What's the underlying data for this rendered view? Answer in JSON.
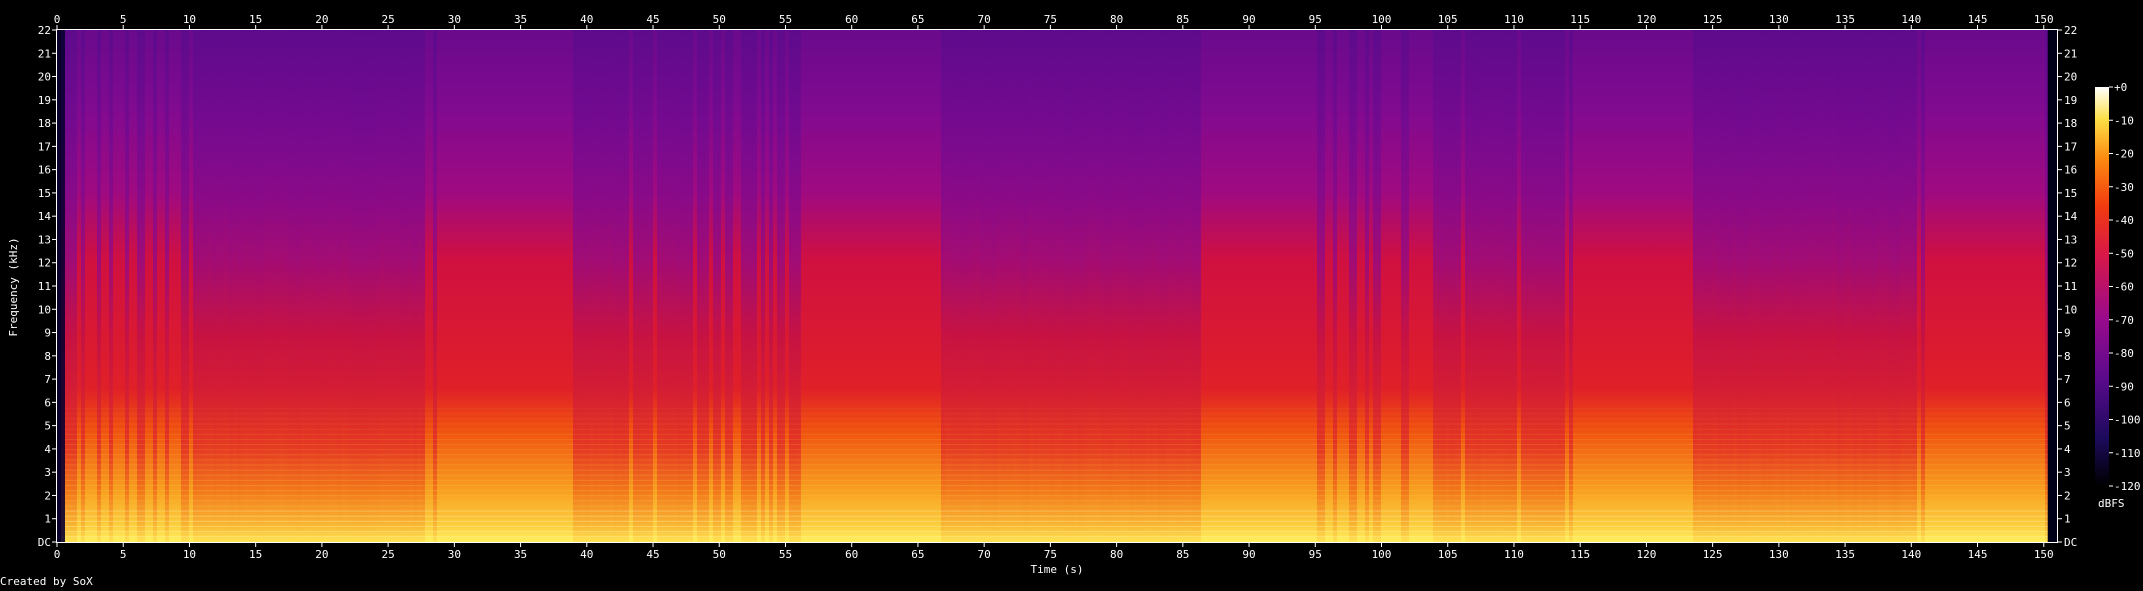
{
  "chart_data": {
    "type": "heatmap",
    "title": "",
    "xlabel": "Time (s)",
    "ylabel": "Frequency (kHz)",
    "xlim": [
      0,
      151
    ],
    "ylim": [
      0,
      22
    ],
    "x_ticks": [
      "0",
      "5",
      "10",
      "15",
      "20",
      "25",
      "30",
      "35",
      "40",
      "45",
      "50",
      "55",
      "60",
      "65",
      "70",
      "75",
      "80",
      "85",
      "90",
      "95",
      "100",
      "105",
      "110",
      "115",
      "120",
      "125",
      "130",
      "135",
      "140",
      "145",
      "150"
    ],
    "y_ticks": [
      "DC",
      "1",
      "2",
      "3",
      "4",
      "5",
      "6",
      "7",
      "8",
      "9",
      "10",
      "11",
      "12",
      "13",
      "14",
      "15",
      "16",
      "17",
      "18",
      "19",
      "20",
      "21",
      "22"
    ],
    "colorbar": {
      "label": "dBFS",
      "ticks": [
        "+0",
        "-10",
        "-20",
        "-30",
        "-40",
        "-50",
        "-60",
        "-70",
        "-80",
        "-90",
        "-100",
        "-110",
        "-120"
      ],
      "range": [
        -120,
        0
      ]
    },
    "energy_profile": {
      "description_time_s": [
        0,
        0.6,
        5,
        10,
        11,
        27,
        29.5,
        38,
        40,
        56,
        57,
        66,
        67,
        86,
        87,
        94,
        95,
        103,
        104,
        114,
        115,
        123,
        124,
        140,
        141,
        150,
        150.5,
        151
      ],
      "loudness": [
        0.0,
        0.7,
        0.75,
        0.72,
        0.6,
        0.62,
        0.85,
        0.82,
        0.65,
        0.66,
        0.85,
        0.82,
        0.6,
        0.62,
        0.88,
        0.85,
        0.72,
        0.74,
        0.64,
        0.66,
        0.82,
        0.8,
        0.62,
        0.64,
        0.82,
        0.8,
        0.2,
        0.0
      ]
    }
  },
  "footer": {
    "text": "Created by SoX"
  },
  "colors": {
    "background": "#000000",
    "text": "#ffffff",
    "palette": [
      "#000000",
      "#1c0a5c",
      "#5a0a8c",
      "#9a0a8c",
      "#d81848",
      "#f23a10",
      "#fc8a10",
      "#fce048",
      "#ffffff"
    ]
  }
}
